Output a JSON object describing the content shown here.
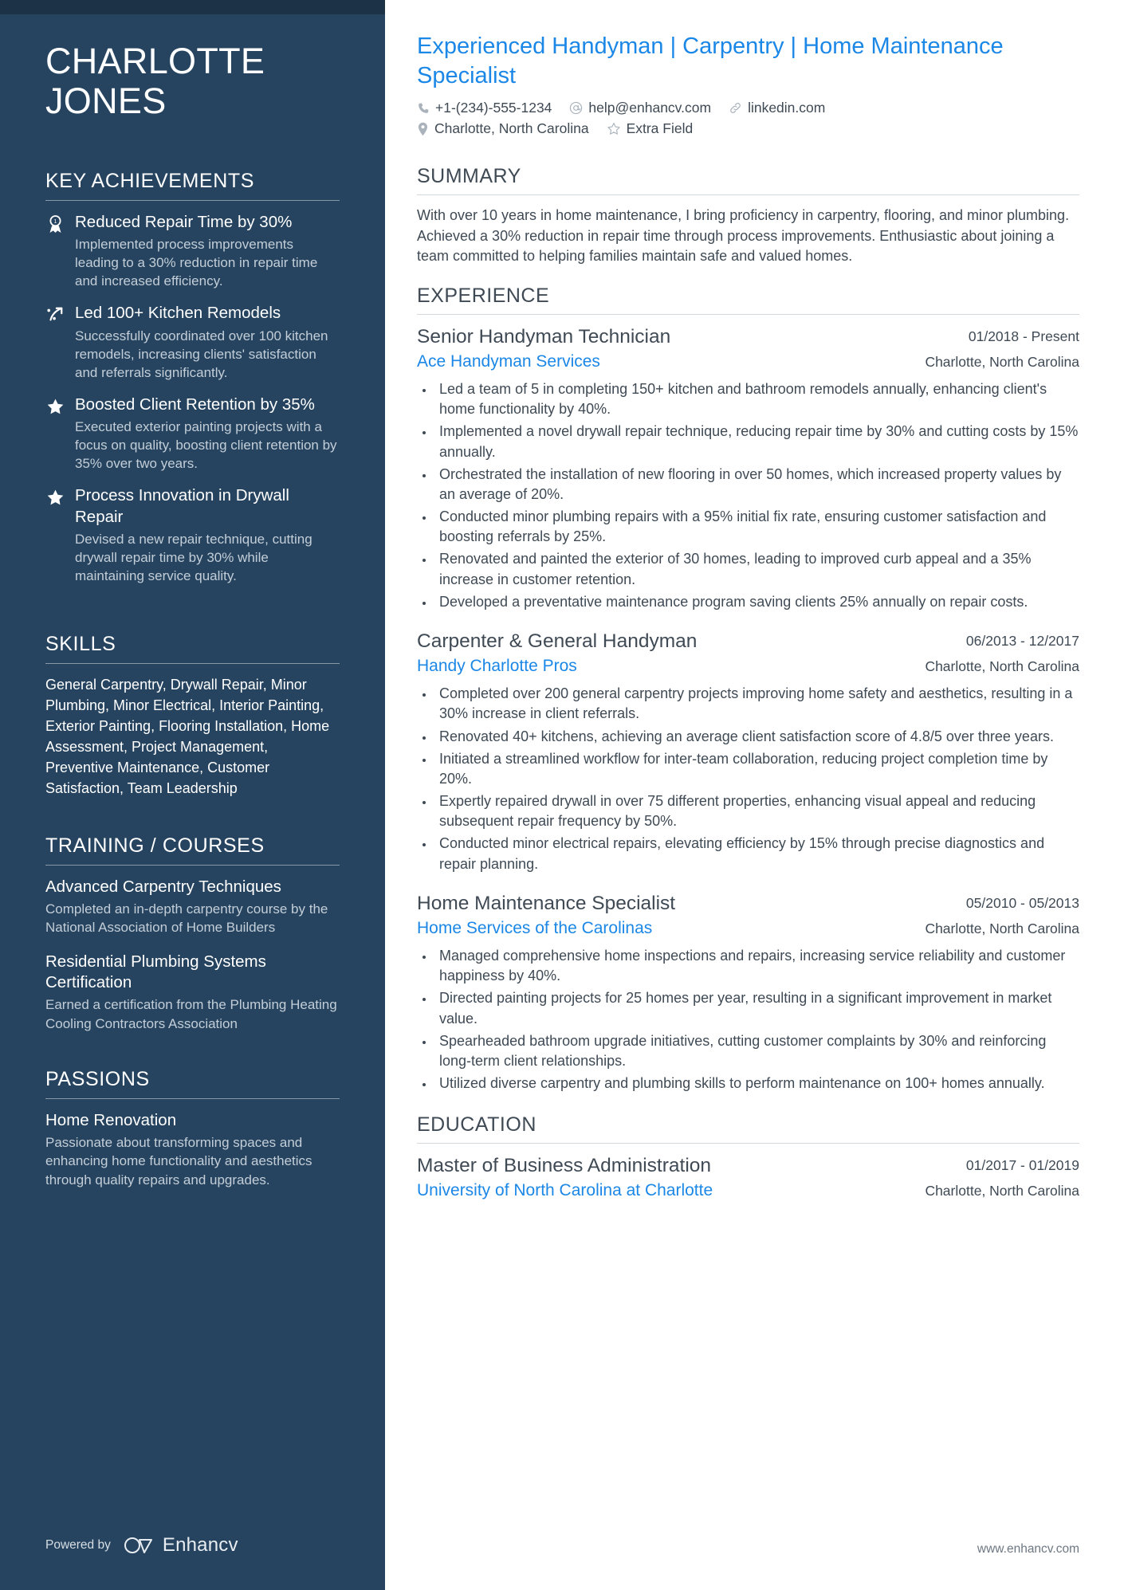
{
  "sidebar": {
    "name_first": "CHARLOTTE",
    "name_last": "JONES",
    "achievements_heading": "KEY ACHIEVEMENTS",
    "achievements": [
      {
        "icon": "award-ribbon-icon",
        "title": "Reduced Repair Time by 30%",
        "desc": "Implemented process improvements leading to a 30% reduction in repair time and increased efficiency."
      },
      {
        "icon": "growth-arrow-icon",
        "title": "Led 100+ Kitchen Remodels",
        "desc": "Successfully coordinated over 100 kitchen remodels, increasing clients' satisfaction and referrals significantly."
      },
      {
        "icon": "star-icon",
        "title": "Boosted Client Retention by 35%",
        "desc": "Executed exterior painting projects with a focus on quality, boosting client retention by 35% over two years."
      },
      {
        "icon": "star-icon",
        "title": "Process Innovation in Drywall Repair",
        "desc": "Devised a new repair technique, cutting drywall repair time by 30% while maintaining service quality."
      }
    ],
    "skills_heading": "SKILLS",
    "skills_text": "General Carpentry, Drywall Repair, Minor Plumbing, Minor Electrical, Interior Painting, Exterior Painting, Flooring Installation, Home Assessment, Project Management, Preventive Maintenance, Customer Satisfaction, Team Leadership",
    "training_heading": "TRAINING / COURSES",
    "training": [
      {
        "title": "Advanced Carpentry Techniques",
        "desc": "Completed an in-depth carpentry course by the National Association of Home Builders"
      },
      {
        "title": "Residential Plumbing Systems Certification",
        "desc": "Earned a certification from the Plumbing Heating Cooling Contractors Association"
      }
    ],
    "passions_heading": "PASSIONS",
    "passions": [
      {
        "title": "Home Renovation",
        "desc": "Passionate about transforming spaces and enhancing home functionality and aesthetics through quality repairs and upgrades."
      }
    ],
    "powered_by": "Powered by",
    "brand": "Enhancv"
  },
  "main": {
    "headline": "Experienced Handyman | Carpentry | Home Maintenance Specialist",
    "contacts_row1": [
      {
        "icon": "phone-icon",
        "text": "+1-(234)-555-1234"
      },
      {
        "icon": "email-at-icon",
        "text": "help@enhancv.com"
      },
      {
        "icon": "link-icon",
        "text": "linkedin.com"
      }
    ],
    "contacts_row2": [
      {
        "icon": "location-pin-icon",
        "text": "Charlotte, North Carolina"
      },
      {
        "icon": "star-outline-icon",
        "text": "Extra Field"
      }
    ],
    "summary_heading": "SUMMARY",
    "summary_text": "With over 10 years in home maintenance, I bring proficiency in carpentry, flooring, and minor plumbing. Achieved a 30% reduction in repair time through process improvements. Enthusiastic about joining a team committed to helping families maintain safe and valued homes.",
    "experience_heading": "EXPERIENCE",
    "experience": [
      {
        "title": "Senior Handyman Technician",
        "org": "Ace Handyman Services",
        "date": "01/2018 - Present",
        "location": "Charlotte, North Carolina",
        "bullets": [
          "Led a team of 5 in completing 150+ kitchen and bathroom remodels annually, enhancing client's home functionality by 40%.",
          "Implemented a novel drywall repair technique, reducing repair time by 30% and cutting costs by 15% annually.",
          "Orchestrated the installation of new flooring in over 50 homes, which increased property values by an average of 20%.",
          "Conducted minor plumbing repairs with a 95% initial fix rate, ensuring customer satisfaction and boosting referrals by 25%.",
          "Renovated and painted the exterior of 30 homes, leading to improved curb appeal and a 35% increase in customer retention.",
          "Developed a preventative maintenance program saving clients 25% annually on repair costs."
        ]
      },
      {
        "title": "Carpenter & General Handyman",
        "org": "Handy Charlotte Pros",
        "date": "06/2013 - 12/2017",
        "location": "Charlotte, North Carolina",
        "bullets": [
          "Completed over 200 general carpentry projects improving home safety and aesthetics, resulting in a 30% increase in client referrals.",
          "Renovated 40+ kitchens, achieving an average client satisfaction score of 4.8/5 over three years.",
          "Initiated a streamlined workflow for inter-team collaboration, reducing project completion time by 20%.",
          "Expertly repaired drywall in over 75 different properties, enhancing visual appeal and reducing subsequent repair frequency by 50%.",
          "Conducted minor electrical repairs, elevating efficiency by 15% through precise diagnostics and repair planning."
        ]
      },
      {
        "title": "Home Maintenance Specialist",
        "org": "Home Services of the Carolinas",
        "date": "05/2010 - 05/2013",
        "location": "Charlotte, North Carolina",
        "bullets": [
          "Managed comprehensive home inspections and repairs, increasing service reliability and customer happiness by 40%.",
          "Directed painting projects for 25 homes per year, resulting in a significant improvement in market value.",
          "Spearheaded bathroom upgrade initiatives, cutting customer complaints by 30% and reinforcing long-term client relationships.",
          "Utilized diverse carpentry and plumbing skills to perform maintenance on 100+ homes annually."
        ]
      }
    ],
    "education_heading": "EDUCATION",
    "education": [
      {
        "title": "Master of Business Administration",
        "org": "University of North Carolina at Charlotte",
        "date": "01/2017 - 01/2019",
        "location": "Charlotte, North Carolina"
      }
    ],
    "footer_url": "www.enhancv.com"
  },
  "colors": {
    "sidebar_bg": "#26445f",
    "sidebar_topbar": "#1b3247",
    "accent_blue": "#1b87e6",
    "body_text": "#3f4a55"
  }
}
